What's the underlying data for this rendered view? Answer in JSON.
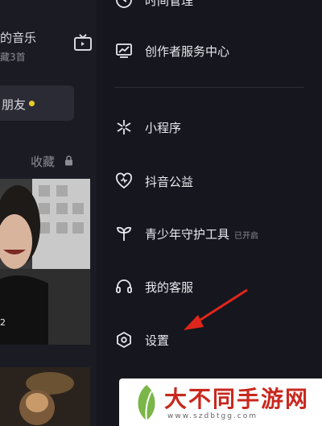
{
  "profile": {
    "music_title": "的音乐",
    "music_sub": "藏3首",
    "friends_label": "朋友",
    "favorites_tab": "收藏",
    "video_count": "2"
  },
  "drawer": {
    "items": [
      {
        "label": "时间管理",
        "icon": "clock-icon"
      },
      {
        "label": "创作者服务中心",
        "icon": "creator-chart-icon"
      },
      {
        "label": "小程序",
        "icon": "mini-program-icon"
      },
      {
        "label": "抖音公益",
        "icon": "charity-heart-icon"
      },
      {
        "label": "青少年守护工具",
        "badge": "已开启",
        "icon": "sprout-icon"
      },
      {
        "label": "我的客服",
        "icon": "headset-icon"
      },
      {
        "label": "设置",
        "icon": "settings-hexagon-icon"
      }
    ]
  },
  "annotation": {
    "color": "#e0261c"
  },
  "watermark": {
    "brand": "大不同手游网",
    "url": "www.szdbtgg.com"
  }
}
